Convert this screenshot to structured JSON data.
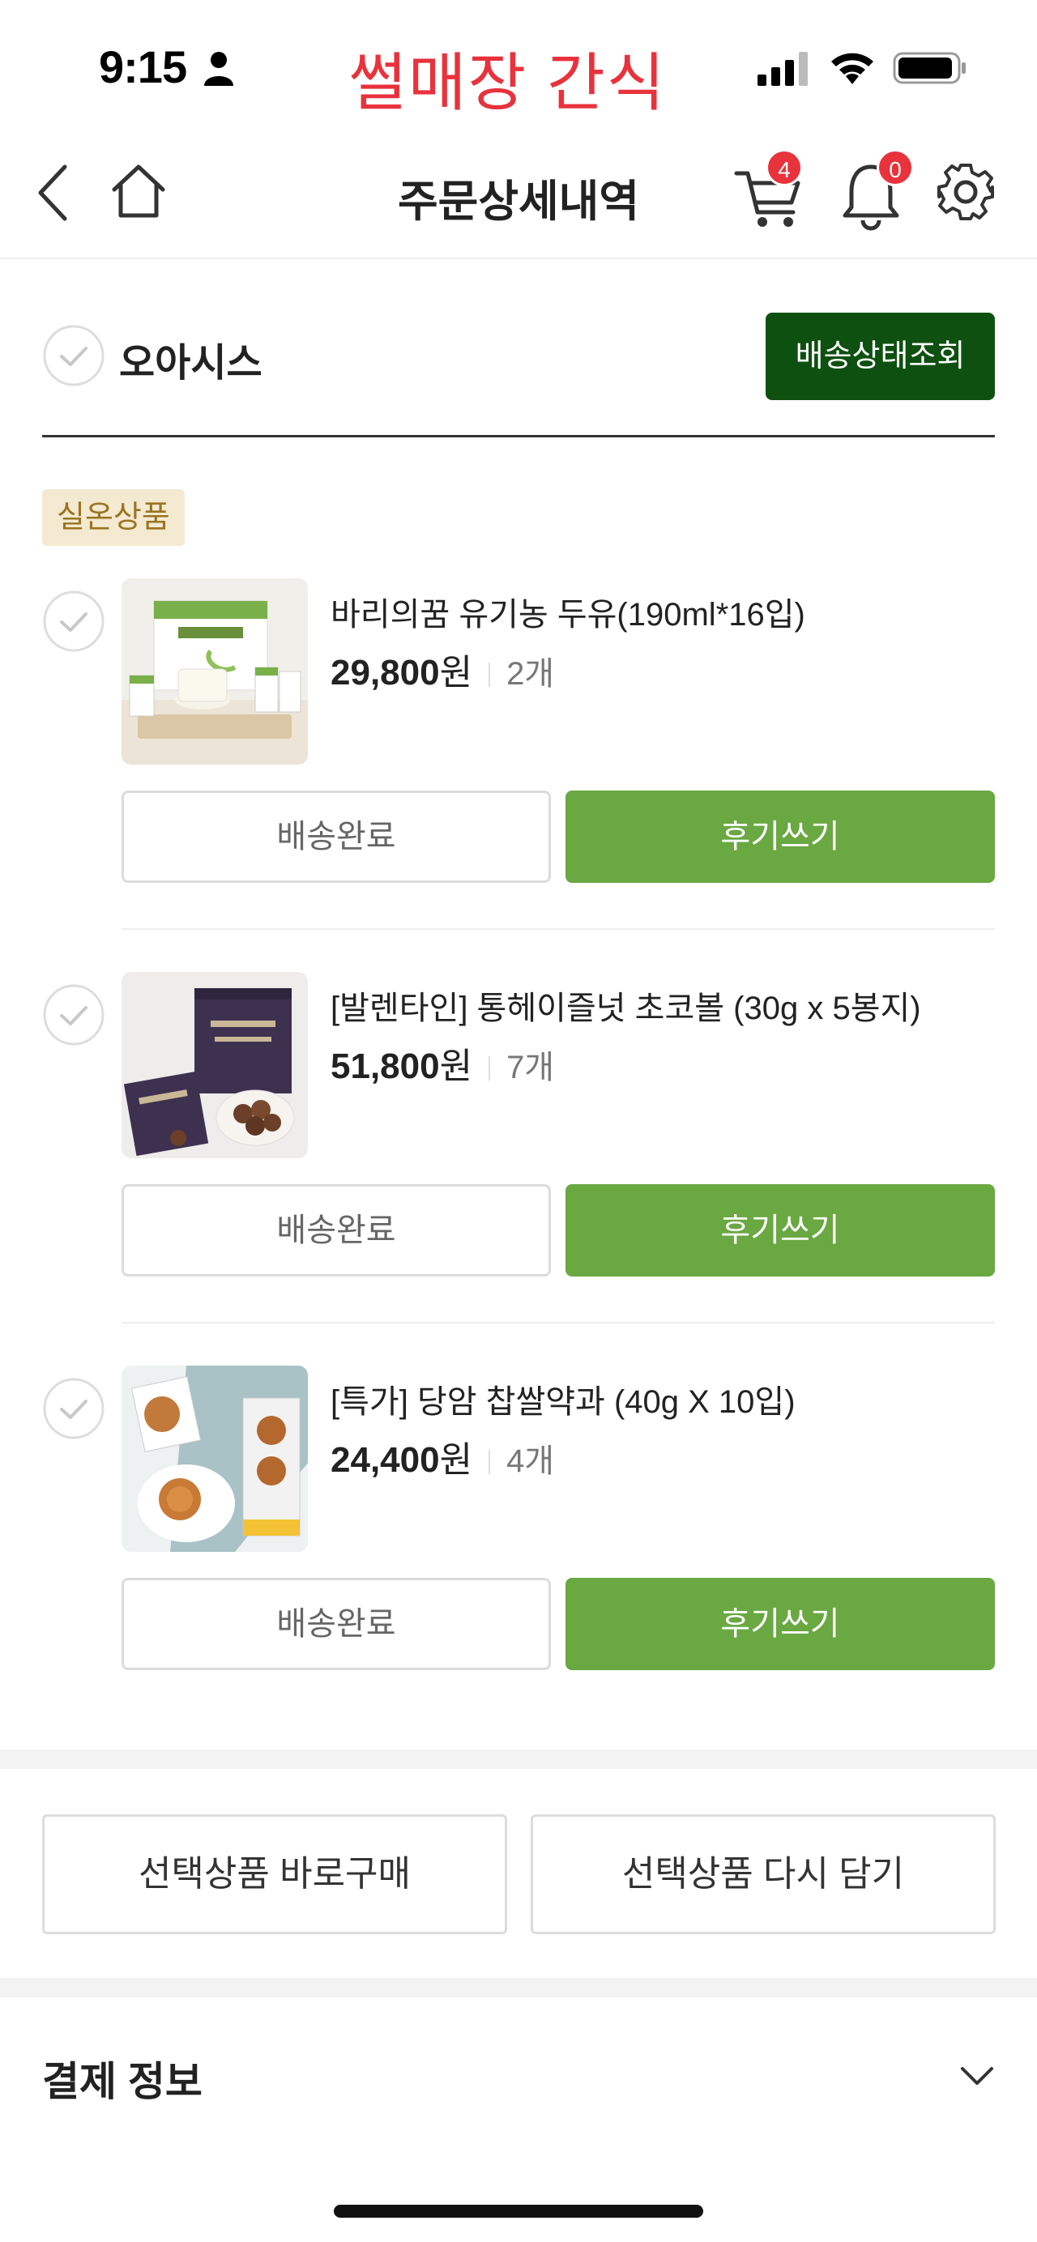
{
  "status_bar": {
    "time": "9:15",
    "overlay_text": "썰매장 간식"
  },
  "nav": {
    "title": "주문상세내역",
    "cart_badge": "4",
    "notification_badge": "0"
  },
  "store": {
    "name": "오아시스",
    "track_button": "배송상태조회"
  },
  "room_temp_badge": "실온상품",
  "products": [
    {
      "name": "바리의꿈 유기농 두유(190ml*16입)",
      "price": "29,800",
      "currency": "원",
      "quantity": "2개",
      "status_button": "배송완료",
      "review_button": "후기쓰기"
    },
    {
      "name": "[발렌타인] 통헤이즐넛 초코볼 (30g x 5봉지)",
      "price": "51,800",
      "currency": "원",
      "quantity": "7개",
      "status_button": "배송완료",
      "review_button": "후기쓰기"
    },
    {
      "name": "[특가] 당암 찹쌀약과 (40g X 10입)",
      "price": "24,400",
      "currency": "원",
      "quantity": "4개",
      "status_button": "배송완료",
      "review_button": "후기쓰기"
    }
  ],
  "actions": {
    "buy_selected": "선택상품 바로구매",
    "re_add_selected": "선택상품 다시 담기"
  },
  "payment": {
    "title": "결제 정보"
  },
  "colors": {
    "accent_green": "#6aa842",
    "dark_green": "#0e5010",
    "badge_red": "#e8323c",
    "badge_bg": "#f4ead1"
  }
}
